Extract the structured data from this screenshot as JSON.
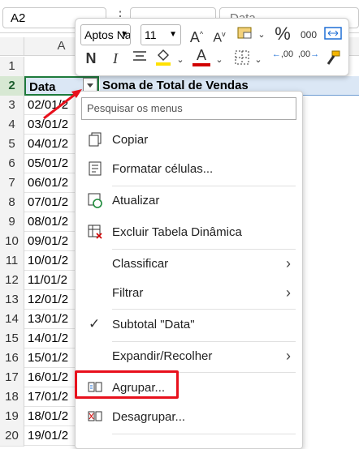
{
  "formula_bar": {
    "name_box": "A2",
    "formula_preview": "Data"
  },
  "sheet": {
    "column_header": "A",
    "row_numbers": [
      "1",
      "2",
      "3",
      "4",
      "5",
      "6",
      "7",
      "8",
      "9",
      "10",
      "11",
      "12",
      "13",
      "14",
      "15",
      "16",
      "17",
      "18",
      "19",
      "20"
    ],
    "header_col_a": "Data",
    "header_col_b": "Soma de Total de Vendas",
    "dates": [
      "02/01/2",
      "03/01/2",
      "04/01/2",
      "05/01/2",
      "06/01/2",
      "07/01/2",
      "08/01/2",
      "09/01/2",
      "10/01/2",
      "11/01/2",
      "12/01/2",
      "13/01/2",
      "14/01/2",
      "15/01/2",
      "16/01/2",
      "17/01/2",
      "18/01/2",
      "19/01/2"
    ]
  },
  "mini_toolbar": {
    "font_name": "Aptos Na",
    "font_size": "11",
    "grow_font": "A",
    "shrink_font": "A",
    "percent": "%",
    "thousands": "000",
    "bold": "N",
    "italic": "I",
    "font_color_letter": "A",
    "decimal_inc": ",00",
    "decimal_dec": ",00"
  },
  "context_menu": {
    "search_placeholder": "Pesquisar os menus",
    "items": [
      {
        "label": "Copiar"
      },
      {
        "label": "Formatar células..."
      },
      {
        "label": "Atualizar"
      },
      {
        "label": "Excluir Tabela Dinâmica"
      },
      {
        "label": "Classificar"
      },
      {
        "label": "Filtrar"
      },
      {
        "label": "Subtotal \"Data\""
      },
      {
        "label": "Expandir/Recolher"
      },
      {
        "label": "Agrupar..."
      },
      {
        "label": "Desagrupar..."
      }
    ]
  },
  "colors": {
    "highlight": "#e8101c",
    "selected_row": "#d7e8d3",
    "pivot_header": "#dbe7f5"
  }
}
